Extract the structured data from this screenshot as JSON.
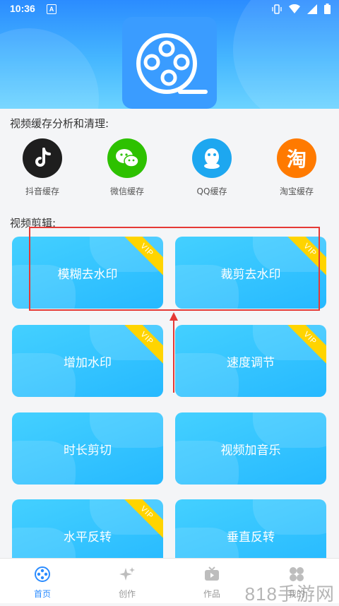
{
  "status": {
    "time": "10:36",
    "notif": "A"
  },
  "section_cache": {
    "title": "视频缓存分析和清理:"
  },
  "cache_items": [
    {
      "label": "抖音缓存",
      "icon": "tiktok-icon",
      "color": "#1e1e1e"
    },
    {
      "label": "微信缓存",
      "icon": "wechat-icon",
      "color": "#2dc100"
    },
    {
      "label": "QQ缓存",
      "icon": "qq-icon",
      "color": "#1da7f0"
    },
    {
      "label": "淘宝缓存",
      "icon": "taobao-icon",
      "color": "#ff7a00",
      "glyph": "淘"
    }
  ],
  "section_edit": {
    "title": "视频剪辑:"
  },
  "tiles": [
    {
      "label": "模糊去水印",
      "vip": true
    },
    {
      "label": "裁剪去水印",
      "vip": true
    },
    {
      "label": "增加水印",
      "vip": true
    },
    {
      "label": "速度调节",
      "vip": true
    },
    {
      "label": "时长剪切",
      "vip": false
    },
    {
      "label": "视频加音乐",
      "vip": false
    },
    {
      "label": "水平反转",
      "vip": true
    },
    {
      "label": "垂直反转",
      "vip": false
    }
  ],
  "vip_label": "VIP",
  "nav": [
    {
      "label": "首页",
      "icon": "film-reel-icon",
      "active": true
    },
    {
      "label": "创作",
      "icon": "sparkle-icon",
      "active": false
    },
    {
      "label": "作品",
      "icon": "tv-icon",
      "active": false
    },
    {
      "label": "我的",
      "icon": "grid-icon",
      "active": false
    }
  ],
  "colors": {
    "accent": "#2b8cff",
    "tile": "#33c4ff",
    "vip": "#ffd400",
    "annotation": "#e53935"
  },
  "watermark": "818手游网"
}
